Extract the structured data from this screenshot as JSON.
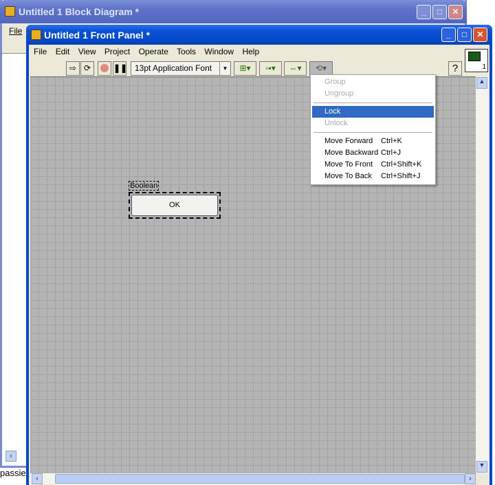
{
  "block_diagram": {
    "title": "Untitled 1 Block Diagram *",
    "menu": [
      "File"
    ]
  },
  "front_panel": {
    "title": "Untitled 1 Front Panel *",
    "menu": [
      "File",
      "Edit",
      "View",
      "Project",
      "Operate",
      "Tools",
      "Window",
      "Help"
    ],
    "font_select": "13pt Application Font",
    "help_label": "?",
    "icon_pane_number": "1"
  },
  "control": {
    "label": "Boolean",
    "button_text": "OK"
  },
  "reorder_menu": {
    "items": [
      {
        "label": "Group",
        "shortcut": "",
        "disabled": true
      },
      {
        "label": "Ungroup",
        "shortcut": "",
        "disabled": true
      },
      {
        "sep": true
      },
      {
        "label": "Lock",
        "shortcut": "",
        "selected": true
      },
      {
        "label": "Unlock",
        "shortcut": "",
        "disabled": true
      },
      {
        "sep": true
      },
      {
        "label": "Move Forward",
        "shortcut": "Ctrl+K"
      },
      {
        "label": "Move Backward",
        "shortcut": "Ctrl+J"
      },
      {
        "label": "Move To Front",
        "shortcut": "Ctrl+Shift+K"
      },
      {
        "label": "Move To Back",
        "shortcut": "Ctrl+Shift+J"
      }
    ]
  },
  "background_text": {
    "left_bottom": "passie"
  }
}
